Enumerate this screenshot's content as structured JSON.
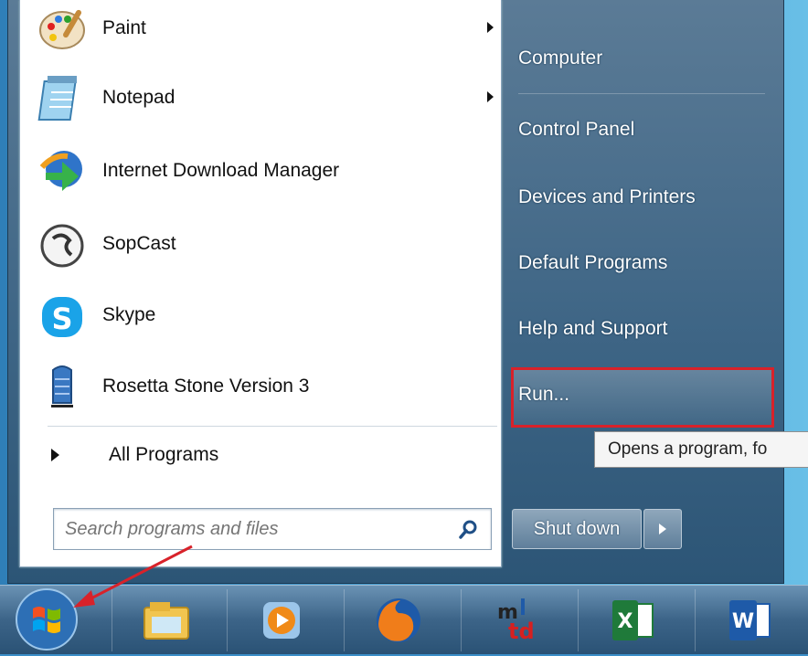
{
  "programs": [
    {
      "label": "Paint",
      "has_submenu": true,
      "icon": "paint-icon"
    },
    {
      "label": "Notepad",
      "has_submenu": true,
      "icon": "notepad-icon"
    },
    {
      "label": "Internet Download Manager",
      "has_submenu": false,
      "icon": "idm-icon"
    },
    {
      "label": "SopCast",
      "has_submenu": false,
      "icon": "sopcast-icon"
    },
    {
      "label": "Skype",
      "has_submenu": false,
      "icon": "skype-icon"
    },
    {
      "label": "Rosetta Stone Version 3",
      "has_submenu": false,
      "icon": "rosetta-stone-icon"
    }
  ],
  "all_programs_label": "All Programs",
  "search": {
    "placeholder": "Search programs and files"
  },
  "right_items": [
    {
      "label": "Computer"
    },
    {
      "label": "Control Panel"
    },
    {
      "label": "Devices and Printers"
    },
    {
      "label": "Default Programs"
    },
    {
      "label": "Help and Support"
    },
    {
      "label": "Run..."
    }
  ],
  "tooltip": "Opens a program, fo",
  "shutdown_label": "Shut down",
  "taskbar": [
    {
      "icon": "windows-start-orb-icon"
    },
    {
      "icon": "file-explorer-icon"
    },
    {
      "icon": "media-player-icon"
    },
    {
      "icon": "firefox-icon"
    },
    {
      "icon": "mtd-app-icon",
      "text": "mtd"
    },
    {
      "icon": "excel-icon"
    },
    {
      "icon": "word-icon"
    }
  ],
  "colors": {
    "highlight_box": "#d8222a",
    "annotation_arrow": "#d8222a"
  }
}
